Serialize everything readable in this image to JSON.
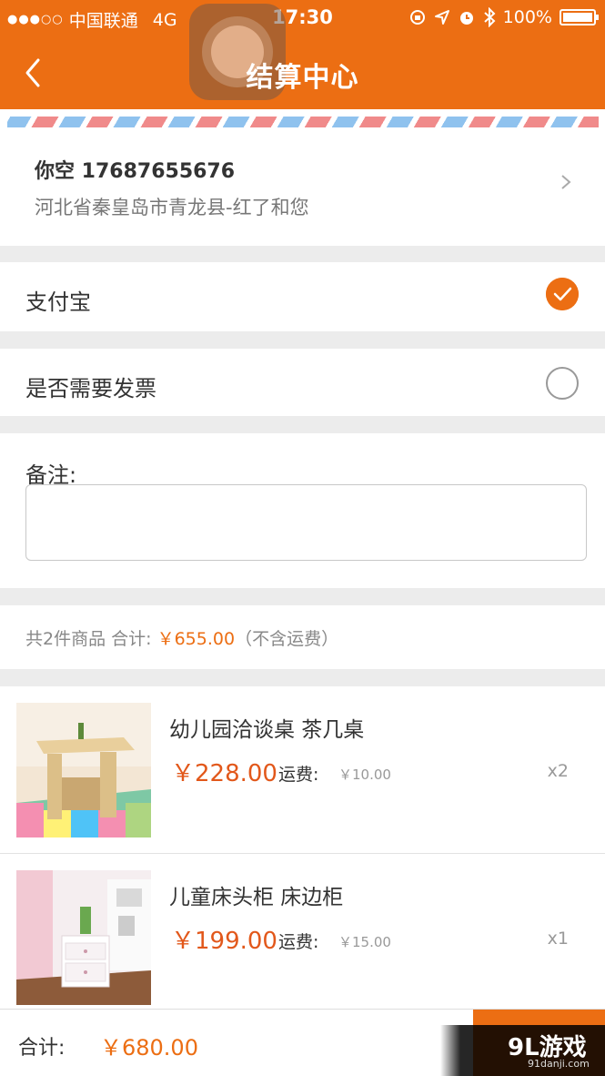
{
  "status_bar": {
    "carrier": "中国联通",
    "network": "4G",
    "time": "17:30",
    "battery": "100%"
  },
  "header": {
    "title": "结算中心"
  },
  "address": {
    "name_phone": "你空 17687655676",
    "detail": "河北省秦皇岛市青龙县-红了和您"
  },
  "payment": {
    "label": "支付宝",
    "selected": true
  },
  "invoice": {
    "label": "是否需要发票",
    "selected": false
  },
  "remark": {
    "label": "备注:",
    "value": ""
  },
  "summary": {
    "prefix": "共2件商品 合计: ",
    "price": "￥655.00",
    "suffix": "（不含运费）"
  },
  "products": [
    {
      "name": "幼儿园洽谈桌 茶几桌",
      "price": "￥228.00",
      "shipping_label": "运费:",
      "shipping": "￥10.00",
      "quantity": "x2"
    },
    {
      "name": "儿童床头柜 床边柜",
      "price": "￥199.00",
      "shipping_label": "运费:",
      "shipping": "￥15.00",
      "quantity": "x1"
    }
  ],
  "footer": {
    "total_label": "合计:",
    "total": "￥680.00"
  },
  "watermark": {
    "main": "9L游戏",
    "sub": "91danji.com"
  },
  "colors": {
    "brand": "#ec6e13",
    "price": "#e2581b"
  }
}
